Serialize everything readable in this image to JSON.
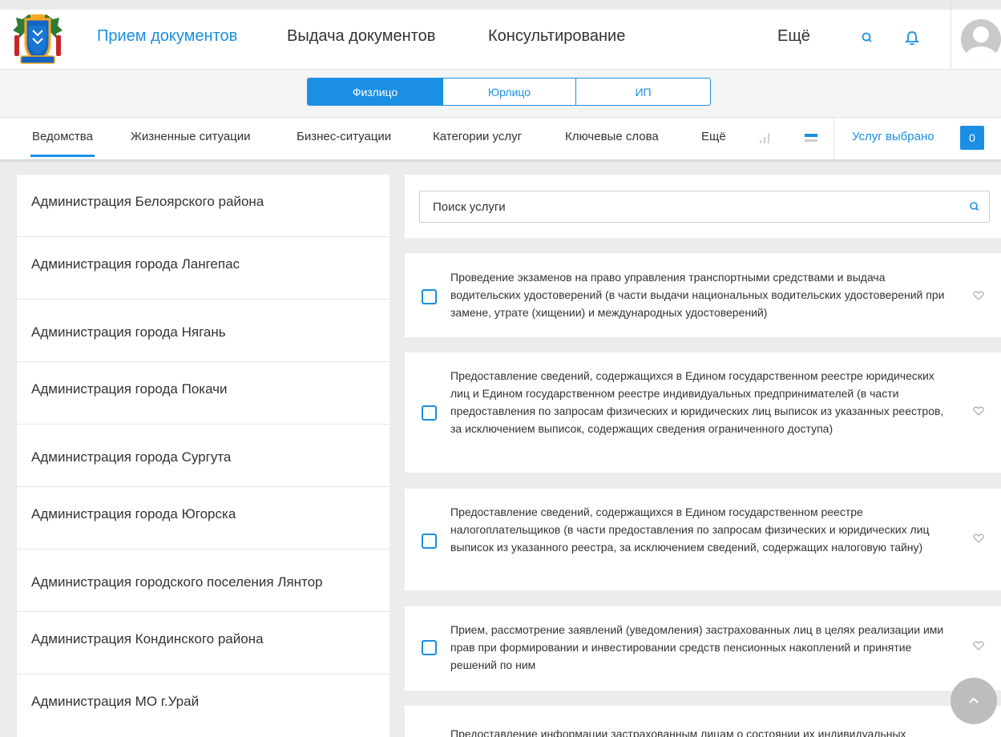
{
  "header": {
    "nav": [
      {
        "label": "Прием документов",
        "active": true
      },
      {
        "label": "Выдача документов",
        "active": false
      },
      {
        "label": "Консультирование",
        "active": false
      }
    ],
    "more_label": "Ещё"
  },
  "person_type": {
    "options": [
      {
        "label": "Физлицо",
        "active": true
      },
      {
        "label": "Юрлицо",
        "active": false
      },
      {
        "label": "ИП",
        "active": false
      }
    ]
  },
  "tabs": {
    "items": [
      {
        "label": "Ведомства",
        "active": true
      },
      {
        "label": "Жизненные ситуации",
        "active": false
      },
      {
        "label": "Бизнес-ситуации",
        "active": false
      },
      {
        "label": "Категории услуг",
        "active": false
      },
      {
        "label": "Ключевые слова",
        "active": false
      },
      {
        "label": "Ещё",
        "active": false
      }
    ],
    "selected_label": "Услуг выбрано",
    "selected_count": "0"
  },
  "departments": [
    "Администрация Белоярского района",
    "Администрация города Лангепас",
    "Администрация города Нягань",
    "Администрация города Покачи",
    "Администрация города Сургута",
    "Администрация города Югорска",
    "Администрация городского поселения Лянтор",
    "Администрация Кондинского района",
    "Администрация МО г.Урай"
  ],
  "search": {
    "placeholder": "Поиск услуги"
  },
  "services": [
    "Проведение экзаменов на право управления транспортными средствами и выдача водительских удостоверений (в части выдачи национальных водительских удостоверений при замене, утрате (хищении) и международных удостоверений)",
    "Предоставление сведений, содержащихся в Едином государственном реестре юридических лиц и Едином государственном реестре индивидуальных предпринимателей (в части предоставления по запросам физических и юридических лиц выписок из указанных реестров, за исключением выписок, содержащих сведения ограниченного доступа)",
    "Предоставление сведений, содержащихся в Едином государственном реестре налогоплательщиков (в части предоставления по запросам физических и юридических лиц выписок из указанного реестра, за исключением сведений, содержащих налоговую тайну)",
    "Прием, рассмотрение заявлений (уведомления) застрахованных лиц в целях реализации ими прав при формировании и инвестировании средств пенсионных накоплений и принятие решений по ним",
    "Предоставление информации застрахованным лицам о состоянии их индивидуальных"
  ],
  "colors": {
    "accent": "#1a8fe3",
    "background": "#ececec"
  }
}
